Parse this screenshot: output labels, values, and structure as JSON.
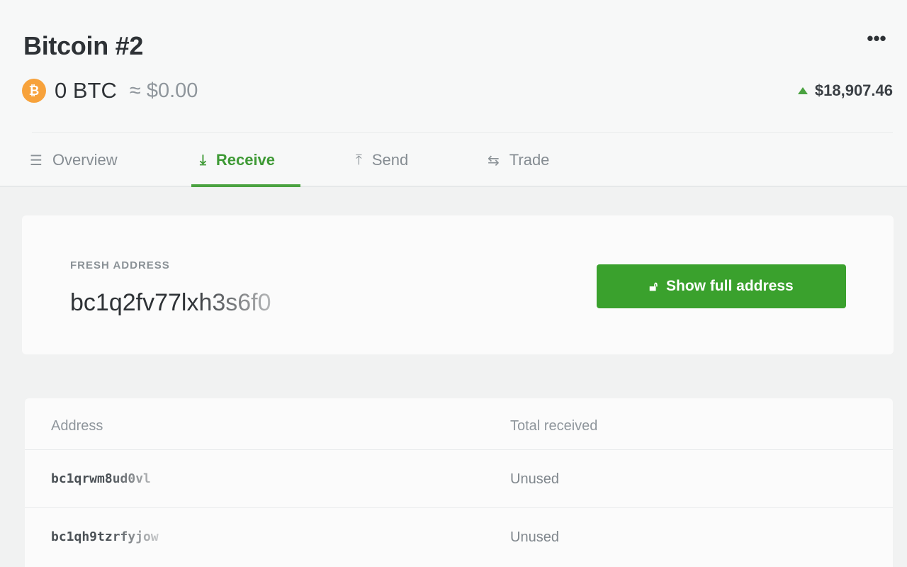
{
  "account": {
    "title": "Bitcoin #2",
    "coin_glyph": "₿",
    "balance": "0 BTC",
    "fiat_equivalent": "≈ $0.00",
    "price": "$18,907.46",
    "price_trend": "up"
  },
  "tabs": [
    {
      "label": "Overview",
      "icon": "list-icon",
      "glyph": "☰",
      "active": false
    },
    {
      "label": "Receive",
      "icon": "download-icon",
      "glyph": "⤓",
      "active": true
    },
    {
      "label": "Send",
      "icon": "upload-icon",
      "glyph": "⤒",
      "active": false
    },
    {
      "label": "Trade",
      "icon": "swap-icon",
      "glyph": "⇆",
      "active": false
    }
  ],
  "fresh_address": {
    "label": "FRESH ADDRESS",
    "value": "bc1q2fv77lxh3s6f0",
    "button_label": "Show full address"
  },
  "address_table": {
    "columns": [
      "Address",
      "Total received"
    ],
    "rows": [
      {
        "address": "bc1qrwm8ud0vl",
        "status": "Unused"
      },
      {
        "address": "bc1qh9tzrfyjow",
        "status": "Unused"
      }
    ]
  },
  "colors": {
    "accent_green": "#3aa12d",
    "coin_orange": "#f7a23b",
    "background": "#f1f2f2"
  }
}
